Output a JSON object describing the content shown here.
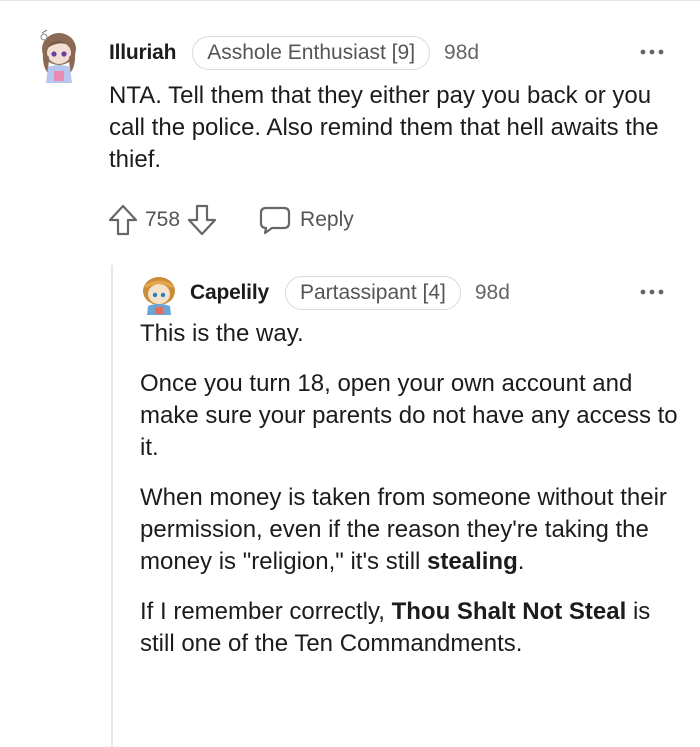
{
  "comments": {
    "parent": {
      "username": "Illuriah",
      "flair": "Asshole Enthusiast [9]",
      "age": "98d",
      "more_icon": "ellipsis-icon",
      "body": "NTA. Tell them that they either pay you back or you call the police. Also remind them that hell awaits the thief.",
      "votes": "758",
      "reply_label": "Reply"
    },
    "reply": {
      "username": "Capelily",
      "flair": "Partassipant [4]",
      "age": "98d",
      "more_icon": "ellipsis-icon",
      "p1": "This is the way.",
      "p2": "Once you turn 18, open your own account and make sure your parents do not have any access to it.",
      "p3_a": "When money is taken from someone without their permission, even if the reason they're taking the money is \"religion,\" it's still ",
      "p3_bold": "stealing",
      "p3_b": ".",
      "p4_a": "If I remember correctly, ",
      "p4_bold": "Thou Shalt Not Steal",
      "p4_b": " is still one of the Ten Commandments."
    }
  },
  "colors": {
    "text": "#1c1c1c",
    "muted": "#555555",
    "border": "#d9d9d9",
    "thread_line": "#e6e6e6"
  }
}
